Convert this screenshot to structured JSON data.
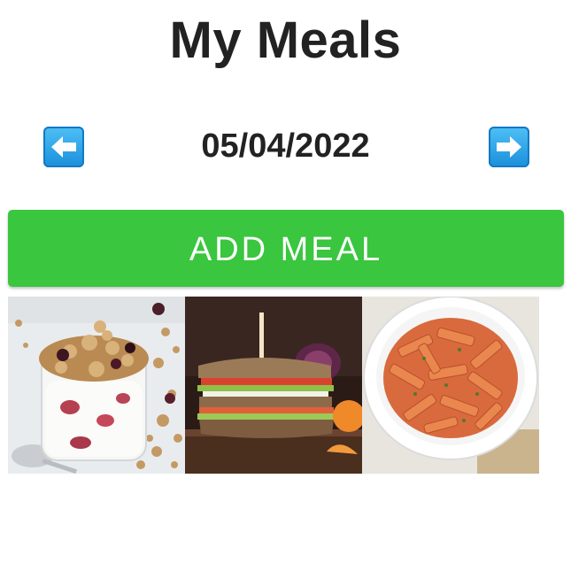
{
  "header": {
    "title": "My Meals"
  },
  "date_nav": {
    "date": "05/04/2022",
    "prev_icon": "left-arrow-icon",
    "next_icon": "right-arrow-icon"
  },
  "actions": {
    "add_meal_label": "ADD MEAL"
  },
  "meals": [
    {
      "image": "granola-yogurt-parfait"
    },
    {
      "image": "vegetable-sandwich"
    },
    {
      "image": "penne-pasta-bowl"
    }
  ],
  "colors": {
    "accent_green": "#3ac63e",
    "arrow_blue": "#1a8fdc",
    "text_dark": "#222222"
  }
}
